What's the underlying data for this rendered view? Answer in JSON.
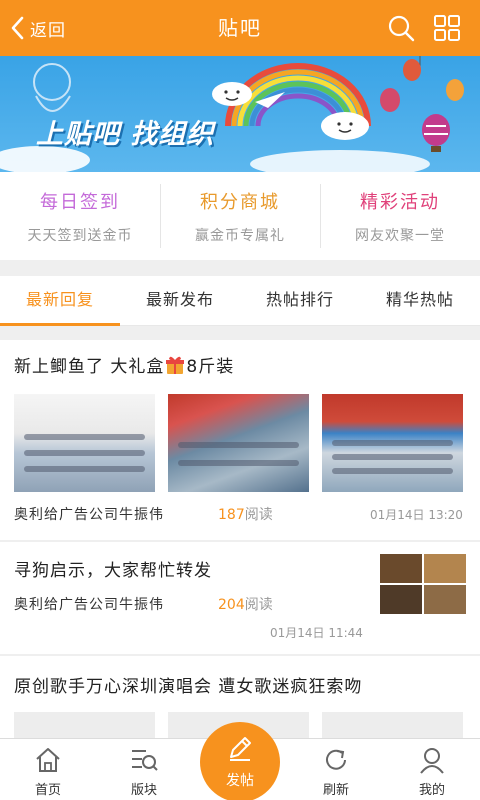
{
  "header": {
    "back_label": "返回",
    "title": "贴吧"
  },
  "banner": {
    "text": "上贴吧 找组织"
  },
  "quick": [
    {
      "title": "每日签到",
      "subtitle": "天天签到送金币",
      "color": "#c46ad9"
    },
    {
      "title": "积分商城",
      "subtitle": "赢金币专属礼",
      "color": "#e89a2c"
    },
    {
      "title": "精彩活动",
      "subtitle": "网友欢聚一堂",
      "color": "#e0417a"
    }
  ],
  "tabs": [
    "最新回复",
    "最新发布",
    "热帖排行",
    "精华热帖"
  ],
  "posts": [
    {
      "title_before": "新上鲫鱼了 大礼盒",
      "title_after": "8斤装",
      "author": "奥利给广告公司牛振伟",
      "reads": "187",
      "reads_unit": "阅读",
      "time": "01月14日 13:20"
    },
    {
      "title": "寻狗启示，大家帮忙转发",
      "author": "奥利给广告公司牛振伟",
      "reads": "204",
      "reads_unit": "阅读",
      "time": "01月14日 11:44"
    },
    {
      "title": "原创歌手万心深圳演唱会 遭女歌迷疯狂索吻"
    }
  ],
  "bottom_nav": {
    "home": "首页",
    "boards": "版块",
    "post": "发帖",
    "refresh": "刷新",
    "mine": "我的"
  },
  "colors": {
    "accent": "#f7921e",
    "banner_sky": "#39a3e6"
  },
  "icons": [
    "chevron-left-icon",
    "search-icon",
    "grid-icon",
    "gift-icon",
    "home-icon",
    "boards-icon",
    "pencil-icon",
    "refresh-icon",
    "user-icon"
  ]
}
